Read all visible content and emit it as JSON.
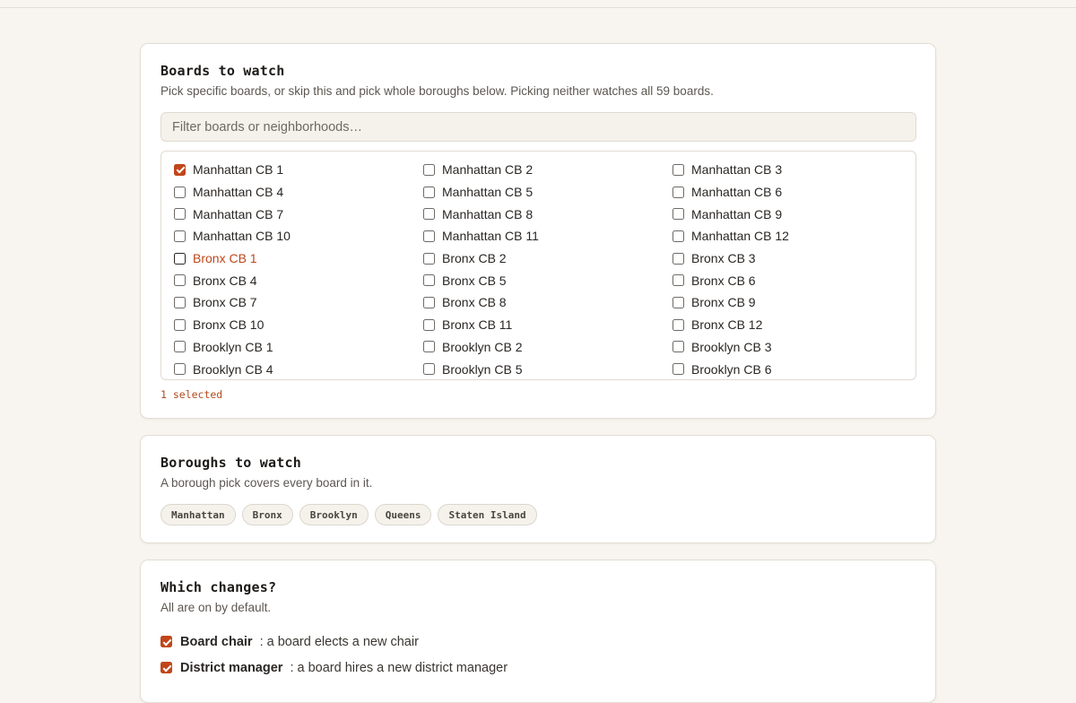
{
  "boards_card": {
    "title": "Boards to watch",
    "subtitle": "Pick specific boards, or skip this and pick whole boroughs below. Picking neither watches all 59 boards.",
    "filter_placeholder": "Filter boards or neighborhoods…",
    "selected_count": "1 selected",
    "boards": [
      {
        "label": "Manhattan CB 1",
        "checked": true
      },
      {
        "label": "Manhattan CB 2",
        "checked": false
      },
      {
        "label": "Manhattan CB 3",
        "checked": false
      },
      {
        "label": "Manhattan CB 4",
        "checked": false
      },
      {
        "label": "Manhattan CB 5",
        "checked": false
      },
      {
        "label": "Manhattan CB 6",
        "checked": false
      },
      {
        "label": "Manhattan CB 7",
        "checked": false
      },
      {
        "label": "Manhattan CB 8",
        "checked": false
      },
      {
        "label": "Manhattan CB 9",
        "checked": false
      },
      {
        "label": "Manhattan CB 10",
        "checked": false
      },
      {
        "label": "Manhattan CB 11",
        "checked": false
      },
      {
        "label": "Manhattan CB 12",
        "checked": false
      },
      {
        "label": "Bronx CB 1",
        "checked": false,
        "hover": true
      },
      {
        "label": "Bronx CB 2",
        "checked": false
      },
      {
        "label": "Bronx CB 3",
        "checked": false
      },
      {
        "label": "Bronx CB 4",
        "checked": false
      },
      {
        "label": "Bronx CB 5",
        "checked": false
      },
      {
        "label": "Bronx CB 6",
        "checked": false
      },
      {
        "label": "Bronx CB 7",
        "checked": false
      },
      {
        "label": "Bronx CB 8",
        "checked": false
      },
      {
        "label": "Bronx CB 9",
        "checked": false
      },
      {
        "label": "Bronx CB 10",
        "checked": false
      },
      {
        "label": "Bronx CB 11",
        "checked": false
      },
      {
        "label": "Bronx CB 12",
        "checked": false
      },
      {
        "label": "Brooklyn CB 1",
        "checked": false
      },
      {
        "label": "Brooklyn CB 2",
        "checked": false
      },
      {
        "label": "Brooklyn CB 3",
        "checked": false
      },
      {
        "label": "Brooklyn CB 4",
        "checked": false
      },
      {
        "label": "Brooklyn CB 5",
        "checked": false
      },
      {
        "label": "Brooklyn CB 6",
        "checked": false
      }
    ]
  },
  "boroughs_card": {
    "title": "Boroughs to watch",
    "subtitle": "A borough pick covers every board in it.",
    "boroughs": [
      "Manhattan",
      "Bronx",
      "Brooklyn",
      "Queens",
      "Staten Island"
    ]
  },
  "changes_card": {
    "title": "Which changes?",
    "subtitle": "All are on by default.",
    "changes": [
      {
        "name": "Board chair",
        "description": ": a board elects a new chair",
        "checked": true
      },
      {
        "name": "District manager",
        "description": ": a board hires a new district manager",
        "checked": true
      }
    ]
  },
  "colors": {
    "accent": "#c0461a",
    "background": "#f8f5f0",
    "card": "#ffffff"
  }
}
